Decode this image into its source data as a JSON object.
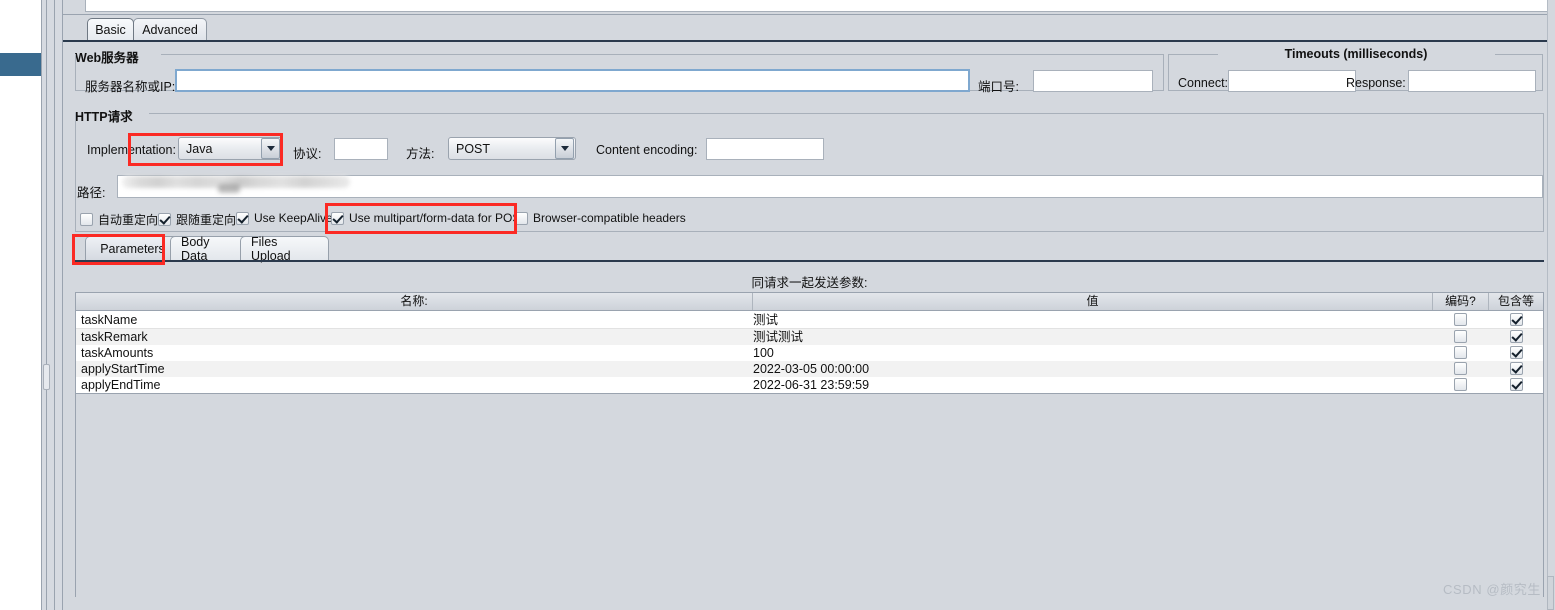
{
  "app": {
    "watermark": "CSDN @颜究生"
  },
  "tabs": {
    "items": [
      {
        "label": "Basic",
        "selected": true
      },
      {
        "label": "Advanced",
        "selected": false
      }
    ]
  },
  "web_server": {
    "title": "Web服务器",
    "server_label": "服务器名称或IP:",
    "server_value": "",
    "port_label": "端口号:",
    "port_value": ""
  },
  "timeouts": {
    "title": "Timeouts (milliseconds)",
    "connect_label": "Connect:",
    "connect_value": "",
    "response_label": "Response:",
    "response_value": ""
  },
  "http_request": {
    "title": "HTTP请求",
    "implementation_label": "Implementation:",
    "implementation_value": "Java",
    "protocol_label": "协议:",
    "protocol_value": "",
    "method_label": "方法:",
    "method_value": "POST",
    "content_encoding_label": "Content encoding:",
    "content_encoding_value": "",
    "path_label": "路径:",
    "path_value": "",
    "options": [
      {
        "label": "自动重定向",
        "checked": false
      },
      {
        "label": "跟随重定向",
        "checked": true
      },
      {
        "label": "Use KeepAlive",
        "checked": true
      },
      {
        "label": "Use multipart/form-data for POST",
        "checked": true
      },
      {
        "label": "Browser-compatible headers",
        "checked": false
      }
    ]
  },
  "inner_tabs": {
    "items": [
      {
        "label": "Parameters",
        "selected": true
      },
      {
        "label": "Body Data",
        "selected": false
      },
      {
        "label": "Files Upload",
        "selected": false
      }
    ]
  },
  "params": {
    "note": "同请求一起发送参数:",
    "columns": [
      "名称:",
      "值",
      "编码?",
      "包含等于?"
    ],
    "rows": [
      {
        "name": "taskName",
        "value": "测试",
        "encode": false,
        "include_equals": true
      },
      {
        "name": "taskRemark",
        "value": "测试测试",
        "encode": false,
        "include_equals": true
      },
      {
        "name": "taskAmounts",
        "value": "100",
        "encode": false,
        "include_equals": true
      },
      {
        "name": "applyStartTime",
        "value": "2022-03-05 00:00:00",
        "encode": false,
        "include_equals": true
      },
      {
        "name": "applyEndTime",
        "value": "2022-06-31 23:59:59",
        "encode": false,
        "include_equals": true
      }
    ]
  },
  "highlights": {
    "accent_color": "#fb2a24",
    "selection_color": "#396a8e"
  }
}
